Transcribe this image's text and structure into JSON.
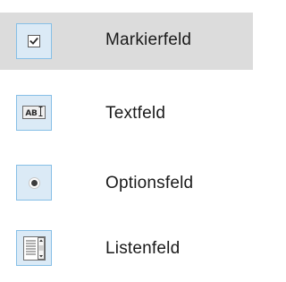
{
  "menu": {
    "items": [
      {
        "label": "Markierfeld",
        "icon": "checkbox-icon",
        "selected": true
      },
      {
        "label": "Textfeld",
        "icon": "textbox-icon",
        "icon_text": "AB",
        "selected": false
      },
      {
        "label": "Optionsfeld",
        "icon": "radio-button-icon",
        "selected": false
      },
      {
        "label": "Listenfeld",
        "icon": "listbox-icon",
        "selected": false
      }
    ]
  },
  "colors": {
    "selected_background": "#dcdcdc",
    "icon_background": "#dbeaf6",
    "icon_border": "#86bfe6",
    "label_text": "#1a1a1a"
  }
}
